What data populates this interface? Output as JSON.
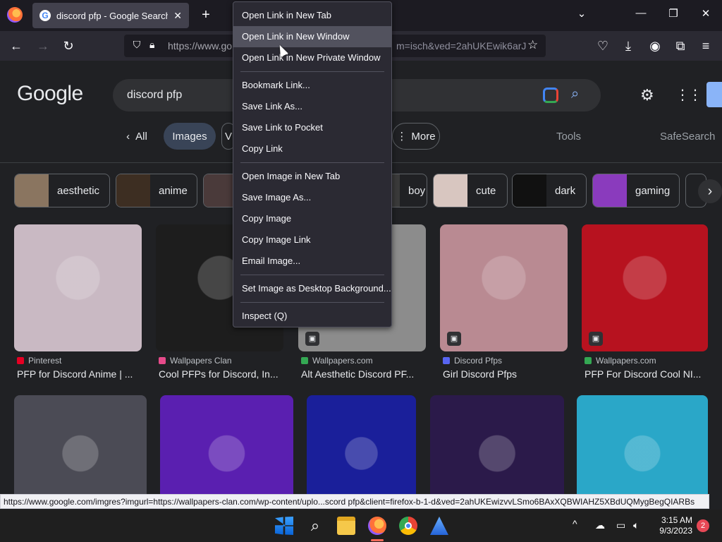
{
  "browser": {
    "tab_title": "discord pfp - Google Search",
    "tab_close": "✕",
    "new_tab": "+",
    "url_prefix": "https://www.go",
    "url_suffix": "m=isch&ved=2ahUKEwik6arJ",
    "window_controls": {
      "minimize": "—",
      "maximize": "❐",
      "close": "✕"
    },
    "list_all_tabs": "⌄"
  },
  "google": {
    "logo": "Google",
    "query": "discord pfp",
    "tabs": {
      "all": "All",
      "images": "Images",
      "v": "V",
      "more": "More"
    },
    "tools": "Tools",
    "safesearch": "SafeSearch",
    "chips": [
      {
        "label": "aesthetic",
        "color": "#8a7560"
      },
      {
        "label": "anime",
        "color": "#3d2e22"
      },
      {
        "label": "",
        "color": "#4a3a3a"
      },
      {
        "label": "boy",
        "color": "#3a3a3a"
      },
      {
        "label": "cute",
        "color": "#d8c6c0"
      },
      {
        "label": "dark",
        "color": "#111111"
      },
      {
        "label": "gaming",
        "color": "#8a3bbd"
      }
    ],
    "results": [
      {
        "source": "Pinterest",
        "caption": "PFP for Discord Anime | ...",
        "fav_color": "#e60023",
        "img_color": "#c9b9c3"
      },
      {
        "source": "Wallpapers Clan",
        "caption": "Cool PFPs for Discord, In...",
        "fav_color": "#e64a8a",
        "img_color": "#1d1d1d"
      },
      {
        "source": "Wallpapers.com",
        "caption": "Alt Aesthetic Discord PF...",
        "fav_color": "#34a853",
        "img_color": "#8c8c8c"
      },
      {
        "source": "Discord Pfps",
        "caption": "Girl Discord Pfps",
        "fav_color": "#5865f2",
        "img_color": "#b98a92"
      },
      {
        "source": "Wallpapers.com",
        "caption": "PFP For Discord Cool NI...",
        "fav_color": "#34a853",
        "img_color": "#b7121f"
      }
    ],
    "row2_colors": [
      "#4b4b55",
      "#5a1fb0",
      "#1a1f9a",
      "#2b1a4a",
      "#2aa7c8"
    ]
  },
  "context_menu": {
    "items": [
      {
        "label": "Open Link in New Tab",
        "highlighted": false
      },
      {
        "label": "Open Link in New Window",
        "highlighted": true
      },
      {
        "label": "Open Link in New Private Window",
        "highlighted": false
      },
      {
        "sep": true
      },
      {
        "label": "Bookmark Link...",
        "highlighted": false
      },
      {
        "label": "Save Link As...",
        "highlighted": false
      },
      {
        "label": "Save Link to Pocket",
        "highlighted": false
      },
      {
        "label": "Copy Link",
        "highlighted": false
      },
      {
        "sep": true
      },
      {
        "label": "Open Image in New Tab",
        "highlighted": false
      },
      {
        "label": "Save Image As...",
        "highlighted": false
      },
      {
        "label": "Copy Image",
        "highlighted": false
      },
      {
        "label": "Copy Image Link",
        "highlighted": false
      },
      {
        "label": "Email Image...",
        "highlighted": false
      },
      {
        "sep": true
      },
      {
        "label": "Set Image as Desktop Background...",
        "highlighted": false
      },
      {
        "sep": true
      },
      {
        "label": "Inspect (Q)",
        "highlighted": false
      }
    ]
  },
  "status_link": "https://www.google.com/imgres?imgurl=https://wallpapers-clan.com/wp-content/uplo...scord pfp&client=firefox-b-1-d&ved=2ahUKEwizvvLSmo6BAxXQBWIAHZ5XBdUQMygBegQIARBs",
  "taskbar": {
    "time": "3:15 AM",
    "date": "9/3/2023",
    "notifications": "2",
    "chevron": "^"
  }
}
